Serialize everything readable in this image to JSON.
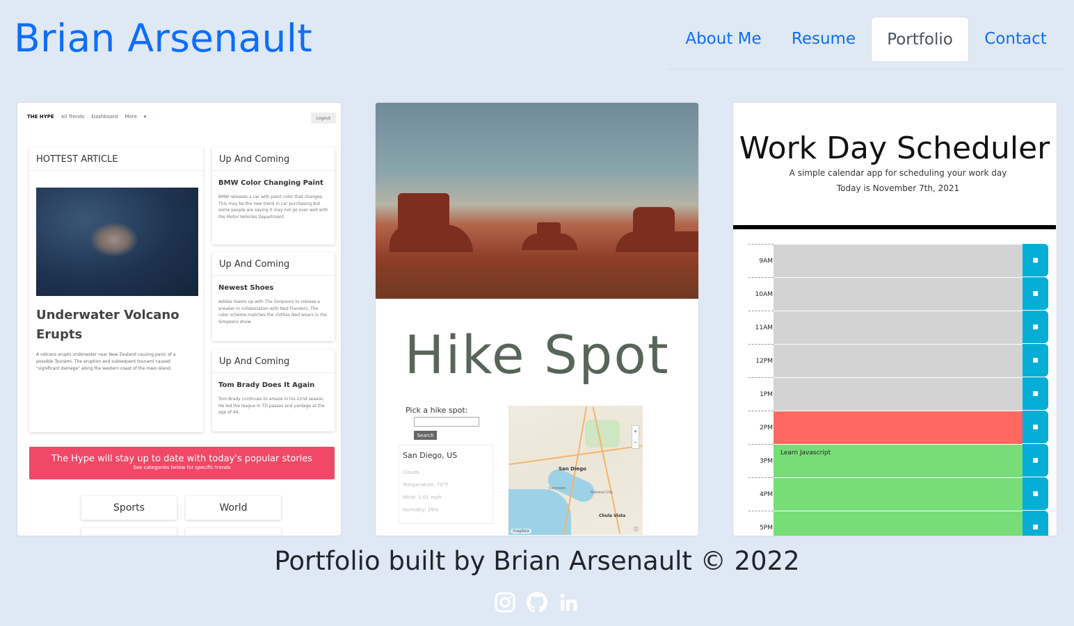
{
  "header": {
    "brand": "Brian Arsenault",
    "nav": [
      {
        "label": "About Me",
        "active": false
      },
      {
        "label": "Resume",
        "active": false
      },
      {
        "label": "Portfolio",
        "active": true
      },
      {
        "label": "Contact",
        "active": false
      }
    ]
  },
  "projects": {
    "hype": {
      "nav_logo": "THE HYPE",
      "nav_links": [
        "All Trends",
        "Dashboard",
        "More"
      ],
      "logout": "Logout",
      "hottest_heading": "HOTTEST ARTICLE",
      "hottest_title": "Underwater Volcano Erupts",
      "hottest_text": "A volcano erupts underwater near New Zealand causing panic of a possible Tsunami. The eruption and subsequent tsunami caused \"significant damage\" along the western coast of the main island.",
      "side_articles": [
        {
          "heading": "Up And Coming",
          "title": "BMW Color Changing Paint",
          "text": "BMW releases a car with paint color that changes. This may be the new trend in car purchasing but some people are saying it may not go over well with the Motor Vehicles Department."
        },
        {
          "heading": "Up And Coming",
          "title": "Newest Shoes",
          "text": "Adidas teams up with The Simpsons to release a sneaker in collaboration with Ned Flanders. The color scheme matches the clothes Ned wears in the Simpsons show."
        },
        {
          "heading": "Up And Coming",
          "title": "Tom Brady Does It Again",
          "text": "Tom Brady continues to amaze in his 22nd season. He led the league in TD passes and yardage at the age of 44."
        }
      ],
      "banner_title": "The Hype will stay up to date with today's popular stories",
      "banner_sub": "See categories below for specific trends",
      "categories": [
        "Sports",
        "World"
      ]
    },
    "hike": {
      "title": "Hike Spot",
      "pick_label": "Pick a hike spot:",
      "search_button": "Search",
      "city": "San Diego, US",
      "weather": [
        "Clouds",
        "Temperature: 70°F",
        "Wind: 1.01 mph",
        "Humidity: 29%"
      ],
      "map_labels": [
        "San Diego",
        "Coronado",
        "National City",
        "Chula Vista"
      ],
      "map_brand": "mapbox"
    },
    "scheduler": {
      "title": "Work Day Scheduler",
      "subtitle": "A simple calendar app for scheduling your work day",
      "date": "Today is November 7th, 2021",
      "rows": [
        {
          "hour": "9AM",
          "text": "",
          "state": "past"
        },
        {
          "hour": "10AM",
          "text": "",
          "state": "past"
        },
        {
          "hour": "11AM",
          "text": "",
          "state": "past"
        },
        {
          "hour": "12PM",
          "text": "",
          "state": "past"
        },
        {
          "hour": "1PM",
          "text": "",
          "state": "past"
        },
        {
          "hour": "2PM",
          "text": "",
          "state": "present"
        },
        {
          "hour": "3PM",
          "text": "Learn Javascript",
          "state": "future"
        },
        {
          "hour": "4PM",
          "text": "",
          "state": "future"
        },
        {
          "hour": "5PM",
          "text": "",
          "state": "future"
        }
      ],
      "colors": {
        "past": "#d3d3d3",
        "present": "#ff6961",
        "future": "#77dd77",
        "save": "#06aed5"
      }
    }
  },
  "footer": {
    "text": "Portfolio built by Brian Arsenault © 2022",
    "socials": [
      "instagram-icon",
      "github-icon",
      "linkedin-icon"
    ]
  },
  "colors": {
    "brand": "#0d6efd",
    "background": "#dfe8f5"
  }
}
